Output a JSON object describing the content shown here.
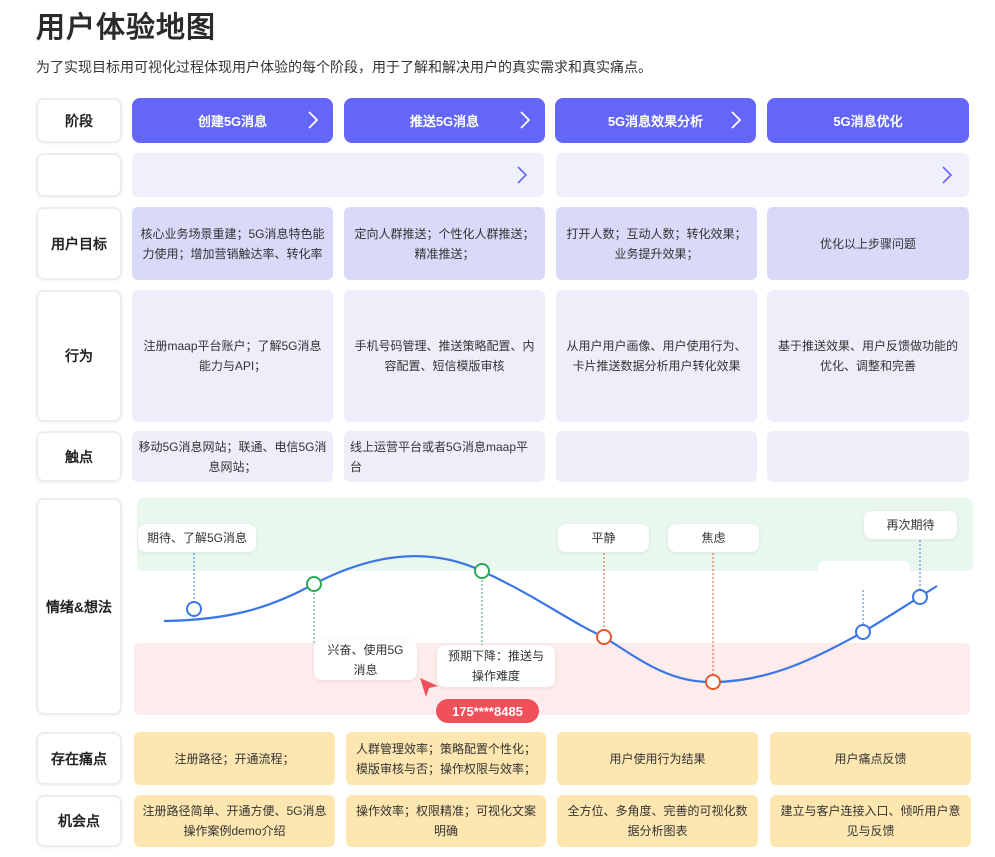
{
  "title": "用户体验地图",
  "subtitle": "为了实现目标用可视化过程体现用户体验的每个阶段，用于了解和解决用户的真实需求和真实痛点。",
  "row_labels": {
    "stage": "阶段",
    "goal": "用户目标",
    "action": "行为",
    "touchpoint": "触点",
    "emotion": "情绪&想法",
    "pain": "存在痛点",
    "opportunity": "机会点"
  },
  "stages": [
    "创建5G消息",
    "推送5G消息",
    "5G消息效果分析",
    "5G消息优化"
  ],
  "goals": [
    "核心业务场景重建；5G消息特色能力使用；增加营销触达率、转化率",
    "定向人群推送；个性化人群推送；精准推送；",
    "打开人数；互动人数；转化效果；业务提升效果；",
    "优化以上步骤问题"
  ],
  "actions": [
    "注册maap平台账户；了解5G消息能力与API；",
    "手机号码管理、推送策略配置、内容配置、短信模版审核",
    "从用户用户画像、用户使用行为、卡片推送数据分析用户转化效果",
    "基于推送效果、用户反馈做功能的优化、调整和完善"
  ],
  "touchpoints": [
    "移动5G消息网站；联通、电信5G消息网站；",
    "线上运营平台或者5G消息maap平台",
    "",
    ""
  ],
  "emotions": {
    "e1": "期待、了解5G消息",
    "e2": "兴奋、使用5G消息",
    "e3": "预期下降：推送与操作难度",
    "e4": "平静",
    "e5": "焦虑",
    "e6": "再次期待"
  },
  "phone_tag": "175****8485",
  "pains": [
    "注册路径；开通流程；",
    "人群管理效率；策略配置个性化；模版审核与否；操作权限与效率；",
    "用户使用行为结果",
    "用户痛点反馈"
  ],
  "opportunities": [
    "注册路径简单、开通方便、5G消息操作案例demo介绍",
    "操作效率；权限精准；可视化文案明确",
    "全方位、多角度、完善的可视化数据分析图表",
    "建立与客户连接入口、倾听用户意见与反馈"
  ],
  "colors": {
    "stage_purple": "#6366f6",
    "goal_lavender": "#d9d9fa",
    "cell_light": "#eeeefb",
    "pain_yellow": "#fde6b0",
    "positive_green": "#e8f8ee",
    "negative_red": "#fdeceb",
    "curve_blue": "#3b76e8",
    "phone_red": "#f0505a"
  }
}
